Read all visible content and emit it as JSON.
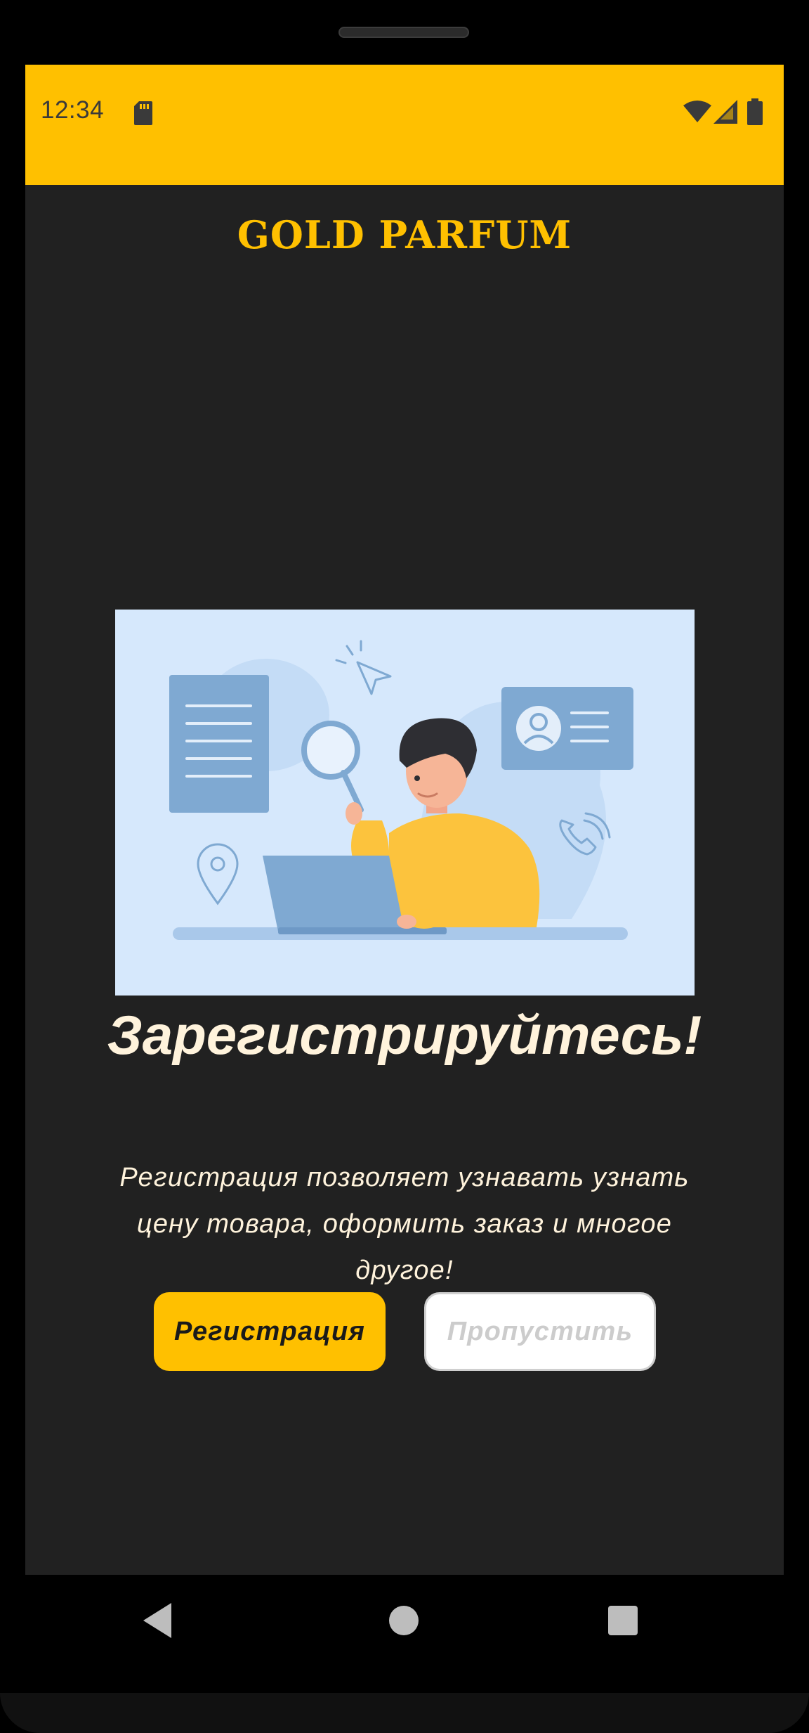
{
  "status_bar": {
    "time": "12:34",
    "bg_color": "#FFC000",
    "icons": [
      "sd-card-icon",
      "wifi-icon",
      "signal-icon",
      "battery-icon"
    ]
  },
  "brand": {
    "title": "GOLD PARFUM",
    "color": "#FFC000"
  },
  "illustration": {
    "icon": "person-with-laptop-illustration"
  },
  "onboarding": {
    "headline": "Зарегистрируйтесь!",
    "description": "Регистрация позволяет узнавать узнать цену товара, оформить заказ и многое другое!"
  },
  "buttons": {
    "register_label": "Регистрация",
    "skip_label": "Пропустить"
  },
  "navigation": {
    "icons": [
      "back-icon",
      "home-icon",
      "recent-apps-icon"
    ]
  },
  "colors": {
    "accent": "#FFC000",
    "background": "#212121",
    "text": "#FFF3DC"
  }
}
